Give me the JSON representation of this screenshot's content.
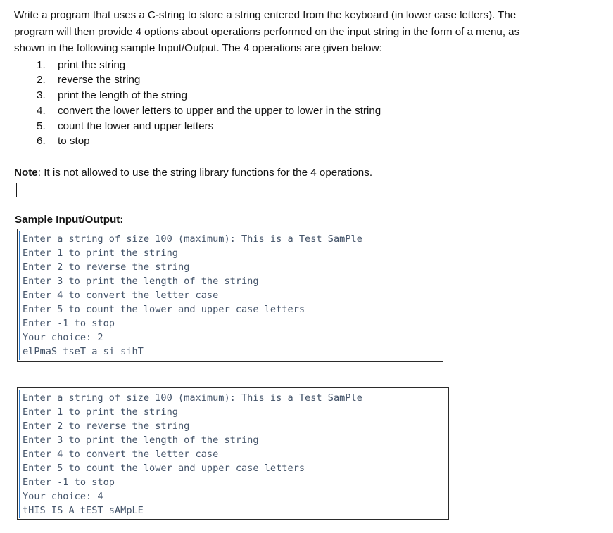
{
  "document": {
    "intro_lines": [
      "Write a program that uses a C-string to store a string entered from the keyboard (in lower case letters). The",
      "program will then provide 4 options about operations performed on the input string in the form of a menu, as",
      "shown in the following sample Input/Output. The 4 operations are given below:"
    ],
    "operations": [
      {
        "number": "1.",
        "text": "print the string"
      },
      {
        "number": "2.",
        "text": "reverse the string"
      },
      {
        "number": "3.",
        "text": "print the length of the string"
      },
      {
        "number": "4.",
        "text": "convert the lower letters to upper and the upper to lower in the string"
      },
      {
        "number": "5.",
        "text": "count the lower and upper letters"
      },
      {
        "number": "6.",
        "text": "to stop"
      }
    ],
    "note": {
      "label": "Note",
      "separator": ": ",
      "text": "It is not allowed to use the string library functions for the 4 operations."
    },
    "sample_heading": "Sample Input/Output:"
  },
  "console_boxes": [
    {
      "name": "reverse-example",
      "lines": [
        "Enter a string of size 100 (maximum): This is a Test SamPle",
        "Enter 1 to print the string",
        "Enter 2 to reverse the string",
        "Enter 3 to print the length of the string",
        "Enter 4 to convert the letter case",
        "Enter 5 to count the lower and upper case letters",
        "Enter -1 to stop",
        "Your choice: 2",
        "elPmaS tseT a si sihT"
      ]
    },
    {
      "name": "case-convert-example",
      "lines": [
        "Enter a string of size 100 (maximum): This is a Test SamPle",
        "Enter 1 to print the string",
        "Enter 2 to reverse the string",
        "Enter 3 to print the length of the string",
        "Enter 4 to convert the letter case",
        "Enter 5 to count the lower and upper case letters",
        "Enter -1 to stop",
        "Your choice: 4",
        "tHIS IS A tEST sAMpLE"
      ]
    }
  ],
  "colors": {
    "console_text": "#44546a",
    "console_border": "#2b2b2b",
    "console_accent": "#2f7fd1",
    "body_text": "#141414"
  }
}
